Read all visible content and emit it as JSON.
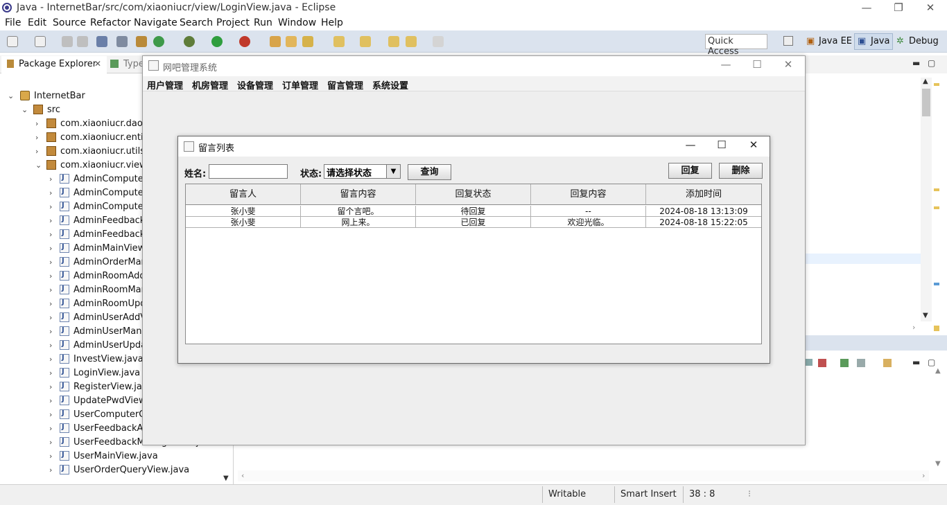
{
  "window": {
    "title": "Java - InternetBar/src/com/xiaoniucr/view/LoginView.java - Eclipse"
  },
  "menubar": [
    "File",
    "Edit",
    "Source",
    "Refactor",
    "Navigate",
    "Search",
    "Project",
    "Run",
    "Window",
    "Help"
  ],
  "toolbar": {
    "quick_access": "Quick Access",
    "perspectives": [
      "Java EE",
      "Java",
      "Debug"
    ]
  },
  "package_explorer": {
    "tab_label": "Package Explorer",
    "second_tab": "Type",
    "project": "InternetBar",
    "src": "src",
    "packages": [
      "com.xiaoniucr.dao",
      "com.xiaoniucr.entity",
      "com.xiaoniucr.utils",
      "com.xiaoniucr.view"
    ],
    "files": [
      "AdminComputerA",
      "AdminComputerM",
      "AdminComputerU",
      "AdminFeedbackM",
      "AdminFeedbackR",
      "AdminMainView.j",
      "AdminOrderMana",
      "AdminRoomAddV",
      "AdminRoomMana",
      "AdminRoomUpda",
      "AdminUserAddVi",
      "AdminUserManag",
      "AdminUserUpdat",
      "InvestView.java",
      "LoginView.java",
      "RegisterView.java",
      "UpdatePwdView.j",
      "UserComputerQu",
      "UserFeedbackAd",
      "UserFeedbackManageView.java",
      "UserMainView.java",
      "UserOrderQueryView.java"
    ]
  },
  "statusbar": {
    "writable": "Writable",
    "insert": "Smart Insert",
    "position": "38 : 8"
  },
  "app_window": {
    "title": "网吧管理系统",
    "menu": [
      "用户管理",
      "机房管理",
      "设备管理",
      "订单管理",
      "留言管理",
      "系统设置"
    ]
  },
  "dialog": {
    "title": "留言列表",
    "name_label": "姓名:",
    "status_label": "状态:",
    "status_value": "请选择状态",
    "query_button": "查询",
    "reply_button": "回复",
    "delete_button": "删除",
    "columns": [
      "留言人",
      "留言内容",
      "回复状态",
      "回复内容",
      "添加时间"
    ],
    "rows": [
      [
        "张小斐",
        "留个言吧。",
        "待回复",
        "--",
        "2024-08-18 13:13:09"
      ],
      [
        "张小斐",
        "网上来。",
        "已回复",
        "欢迎光临。",
        "2024-08-18 15:22:05"
      ]
    ]
  }
}
